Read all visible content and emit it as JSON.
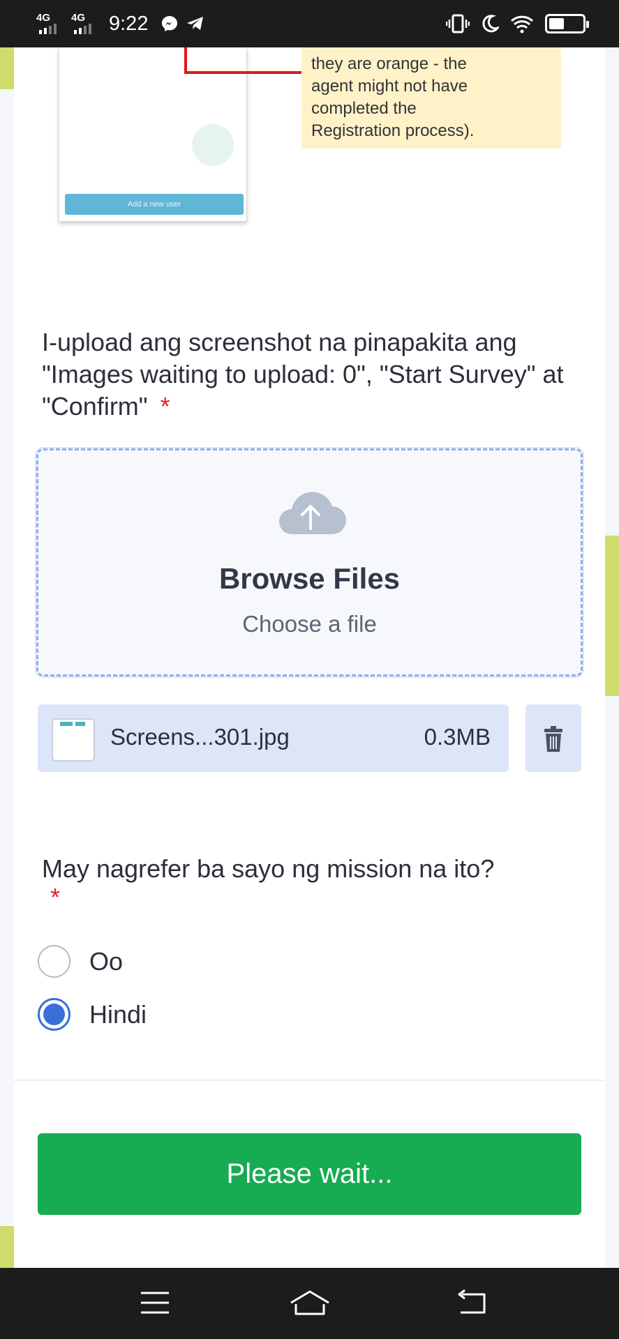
{
  "status_bar": {
    "signal_1": "4G",
    "signal_2": "4G",
    "time": "9:22",
    "icons": [
      "messenger-icon",
      "telegram-icon",
      "vibrate-icon",
      "moon-icon",
      "wifi-icon",
      "battery-icon"
    ],
    "battery_level": 0.45
  },
  "instruction_image": {
    "note_text": "they are orange - the\nagent might not have\ncompleted the\nRegistration process).",
    "button_label": "Add a new user"
  },
  "question_upload": {
    "label": "I-upload ang screenshot na pinapakita ang \"Images waiting to upload: 0\", \"Start Survey\" at \"Confirm\"",
    "required_mark": "*",
    "dropzone": {
      "title": "Browse Files",
      "subtitle": "Choose a file"
    },
    "file": {
      "name": "Screens...301.jpg",
      "size": "0.3MB"
    }
  },
  "question_referral": {
    "label": "May nagrefer ba sayo ng mission na ito?",
    "required_mark": "*",
    "options": [
      {
        "label": "Oo",
        "checked": false
      },
      {
        "label": "Hindi",
        "checked": true
      }
    ]
  },
  "submit_button": {
    "label": "Please wait...",
    "color": "#17ab52"
  },
  "colors": {
    "accent": "#3b6fd8",
    "required": "#e02424",
    "note_bg": "#fff2c9"
  }
}
